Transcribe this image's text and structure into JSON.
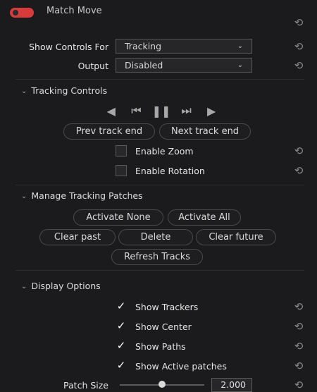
{
  "header": {
    "title": "Match Move",
    "enabled": true
  },
  "controls": {
    "show_controls_for": {
      "label": "Show Controls For",
      "value": "Tracking"
    },
    "output": {
      "label": "Output",
      "value": "Disabled"
    }
  },
  "tracking_controls": {
    "title": "Tracking Controls",
    "prev_track_end": "Prev track end",
    "next_track_end": "Next track end",
    "enable_zoom": {
      "label": "Enable Zoom",
      "checked": false
    },
    "enable_rotation": {
      "label": "Enable Rotation",
      "checked": false
    }
  },
  "patches": {
    "title": "Manage Tracking Patches",
    "activate_none": "Activate None",
    "activate_all": "Activate All",
    "clear_past": "Clear past",
    "delete": "Delete",
    "clear_future": "Clear future",
    "refresh_tracks": "Refresh Tracks"
  },
  "display": {
    "title": "Display Options",
    "show_trackers": {
      "label": "Show Trackers",
      "checked": true
    },
    "show_center": {
      "label": "Show Center",
      "checked": true
    },
    "show_paths": {
      "label": "Show Paths",
      "checked": true
    },
    "show_active_patches": {
      "label": "Show Active patches",
      "checked": true
    },
    "patch_size": {
      "label": "Patch Size",
      "value": "2.000",
      "slider_fraction": 0.5
    }
  },
  "colors": {
    "toggle_on": "#d83b3b",
    "background": "#1b1b1d"
  },
  "icons": {
    "reset": "reset-icon",
    "chevron": "chevron-down-icon"
  }
}
